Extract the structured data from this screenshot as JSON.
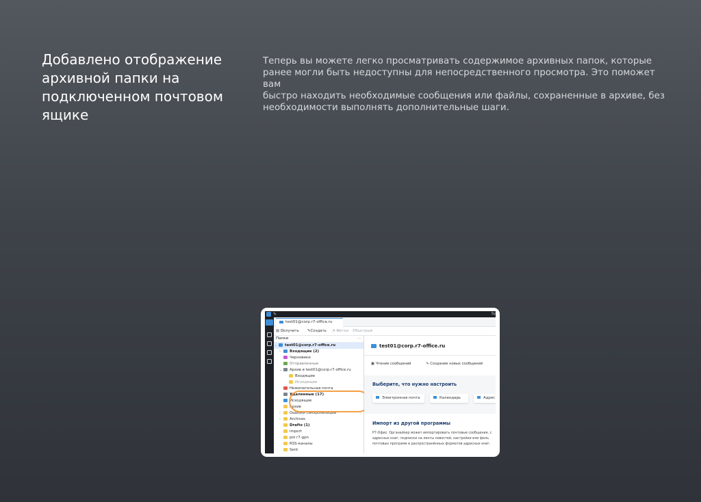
{
  "headline": "Добавлено отображение\nархивной папки на\nподключенном почтовом\nящике",
  "description": "Теперь вы можете легко просматривать содержимое архивных папок, которые\nранее могли быть недоступны для непосредственного просмотра. Это поможет вам\nбыстро находить необходимые сообщения или файлы, сохраненные в архиве, без\nнеобходимости выполнять дополнительные шаги.",
  "app": {
    "titlebar_right": "Sy",
    "tab_label": "test01@corp.r7-office.ru",
    "toolbar": {
      "get": "Получить",
      "create": "Создать",
      "tags": "Метки",
      "quick_filter": "Быстрый фильтр"
    },
    "folders_header": "Папки",
    "folders_more": "···",
    "folders": {
      "account": "test01@corp.r7-office.ru",
      "inbox": "Входящие (2)",
      "drafts": "Черновики",
      "sent": "Отправленные",
      "archive_root": "Архив в test01@corp.r7-office.ru",
      "archive_inbox": "Входящие",
      "archive_cut": "Исходящие",
      "junk": "Нежелательная почта",
      "trash": "Удаленные (17)",
      "outbox": "Исходящие",
      "archive": "Архив",
      "sync_errors": "Ошибки синхронизации",
      "archives": "Archives",
      "drafts_en": "Drafts (1)",
      "import": "import",
      "pst": "pst r7-gpn",
      "rss": "RSS-каналы",
      "sent_en": "Sent"
    },
    "right": {
      "account_title": "test01@corp.r7-office.ru",
      "link_read": "Чтение сообщений",
      "link_compose": "Создание новых сообщений",
      "link_search": "По",
      "setup_title": "Выберите, что нужно настроить",
      "card_email": "Электронная почта",
      "card_calendar": "Календарь",
      "card_address": "Адрес",
      "import_title": "Импорт из другой программы",
      "import_text": "Р7-Офис. Органайзер может импортировать почтовые сообщения, с\nадресных книг, подписки на ленты новостей, настройки или филь\nпочтовых программ и распространённых форматов адресных книг."
    }
  }
}
